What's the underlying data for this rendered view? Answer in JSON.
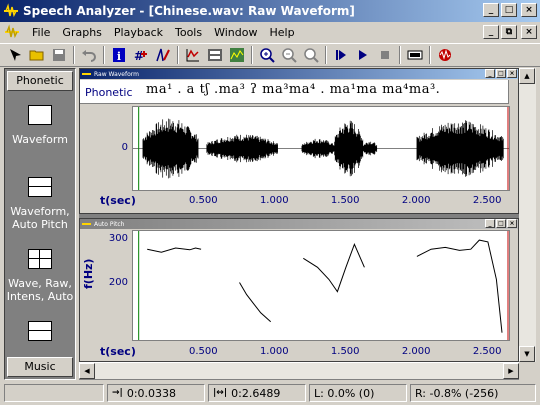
{
  "window": {
    "title": "Speech Analyzer - [Chinese.wav: Raw Waveform]",
    "icon": "speech-analyzer-icon",
    "buttons": [
      "_",
      "□",
      "×"
    ]
  },
  "menu": {
    "items": [
      "File",
      "Graphs",
      "Playback",
      "Tools",
      "Window",
      "Help"
    ],
    "mdi_buttons": [
      "_",
      "⧉",
      "×"
    ]
  },
  "toolbar": {
    "icons": [
      "select-icon",
      "open-folder-icon",
      "save-icon",
      "undo-icon",
      "info-icon",
      "add-graph-icon",
      "edit-graph-icon",
      "raw-pitch-icon",
      "layout-icon",
      "spectrum-icon",
      "zoom-in-icon",
      "zoom-out-icon",
      "zoom-fit-icon",
      "play-start-icon",
      "play-icon",
      "stop-icon",
      "record-icon",
      "monitor-icon"
    ]
  },
  "sidebar": {
    "top_tab": "Phonetic",
    "bottom_tab": "Music",
    "items": [
      {
        "label": "Waveform",
        "icon": "single-graph-icon"
      },
      {
        "label": "Waveform, Auto Pitch",
        "icon": "two-graph-icon"
      },
      {
        "label": "Wave, Raw, Intens, Auto",
        "icon": "four-graph-icon"
      },
      {
        "label": "",
        "icon": "stacked-graph-icon"
      }
    ]
  },
  "raw_waveform": {
    "title": "Raw Waveform",
    "phonetic_label": "Phonetic",
    "phonetic_text": "ma¹ . a   tʃ   .ma³   ʔ ma³ma⁴   .        ma¹ma ma⁴ma³.",
    "y_tick": "0",
    "x_label": "t(sec)",
    "x_ticks": [
      "0.500",
      "1.000",
      "1.500",
      "2.000",
      "2.500"
    ]
  },
  "auto_pitch": {
    "title": "Auto Pitch",
    "y_label": "f(Hz)",
    "y_ticks": [
      "300",
      "200"
    ],
    "x_label": "t(sec)",
    "x_ticks": [
      "0.500",
      "1.000",
      "1.500",
      "2.000",
      "2.500"
    ]
  },
  "chart_data": [
    {
      "type": "line",
      "name": "raw_waveform",
      "xlabel": "t(sec)",
      "xlim": [
        0.0,
        2.649
      ],
      "segments": [
        {
          "start": 0.07,
          "end": 0.46,
          "amp": 0.75
        },
        {
          "start": 0.52,
          "end": 1.02,
          "amp": 0.35
        },
        {
          "start": 1.19,
          "end": 1.42,
          "amp": 0.25
        },
        {
          "start": 1.42,
          "end": 1.62,
          "amp": 0.7
        },
        {
          "start": 1.62,
          "end": 1.72,
          "amp": 0.2
        },
        {
          "start": 2.0,
          "end": 2.61,
          "amp": 0.7
        }
      ]
    },
    {
      "type": "line",
      "name": "auto_pitch",
      "xlabel": "t(sec)",
      "ylabel": "f(Hz)",
      "xlim": [
        0.0,
        2.649
      ],
      "ylim": [
        130,
        310
      ],
      "series": [
        {
          "x": [
            0.1,
            0.2,
            0.3,
            0.4,
            0.44,
            0.48
          ],
          "y": [
            280,
            275,
            282,
            279,
            282,
            280
          ]
        },
        {
          "x": [
            0.75,
            0.8,
            0.85,
            0.9,
            0.97
          ],
          "y": [
            225,
            205,
            190,
            175,
            160
          ]
        },
        {
          "x": [
            1.2,
            1.3,
            1.38,
            1.44,
            1.5,
            1.56,
            1.63
          ],
          "y": [
            265,
            250,
            230,
            210,
            250,
            288,
            250
          ]
        },
        {
          "x": [
            2.0,
            2.1,
            2.2,
            2.3,
            2.38,
            2.44,
            2.5,
            2.56,
            2.6
          ],
          "y": [
            268,
            280,
            283,
            278,
            280,
            295,
            292,
            230,
            142
          ]
        }
      ]
    }
  ],
  "status": {
    "start": "0:0.0338",
    "length": "0:2.6489",
    "left": "L:  0.0%  (0)",
    "right": "R:  -0.8%  (-256)"
  }
}
